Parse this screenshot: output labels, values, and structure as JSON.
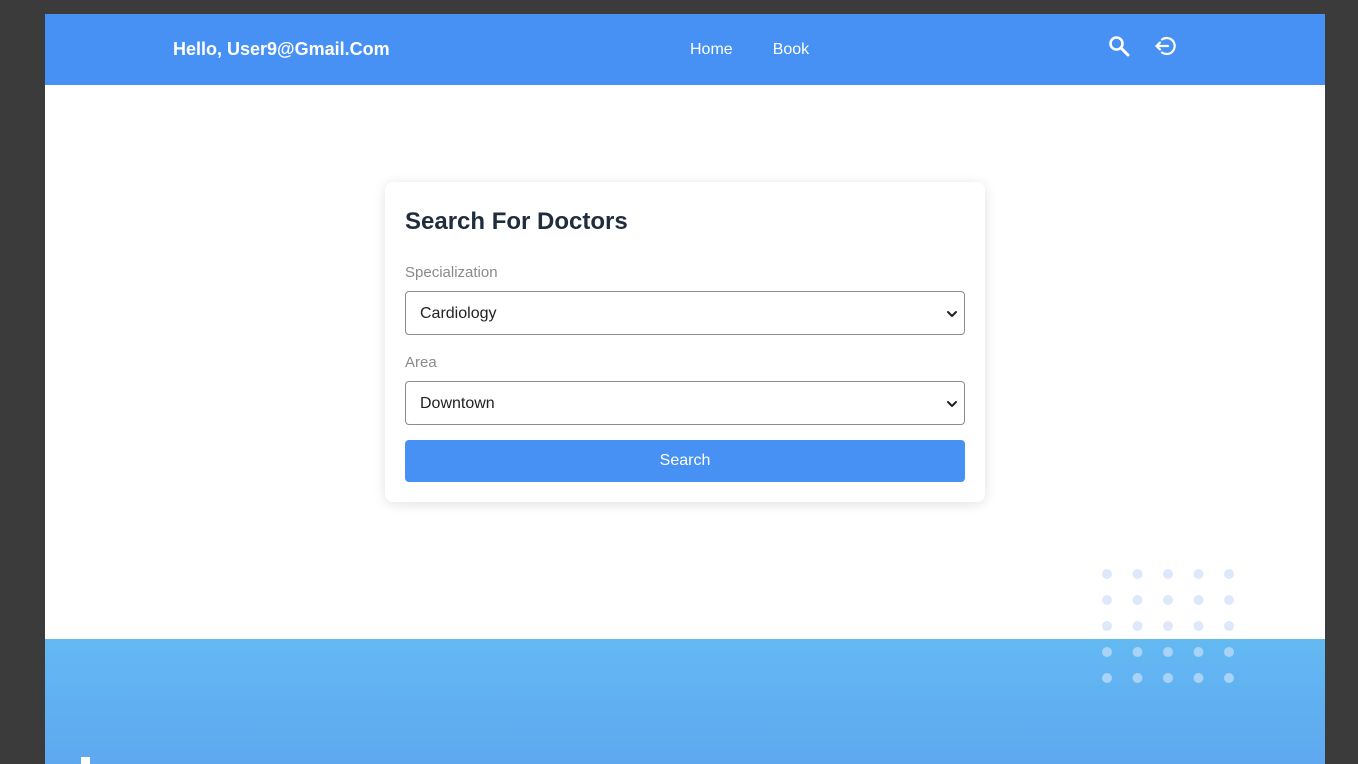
{
  "header": {
    "greeting": "Hello, User9@Gmail.Com",
    "nav": [
      {
        "label": "Home"
      },
      {
        "label": "Book"
      }
    ],
    "icons": [
      "search-icon",
      "logout-icon"
    ]
  },
  "search_card": {
    "title": "Search For Doctors",
    "specialization": {
      "label": "Specialization",
      "value": "Cardiology"
    },
    "area": {
      "label": "Area",
      "value": "Downtown"
    },
    "button_label": "Search"
  },
  "colors": {
    "primary": "#4791f4",
    "footer": "#63b9f2",
    "title_text": "#1f2d3d",
    "label_text": "#8a8a8a"
  }
}
